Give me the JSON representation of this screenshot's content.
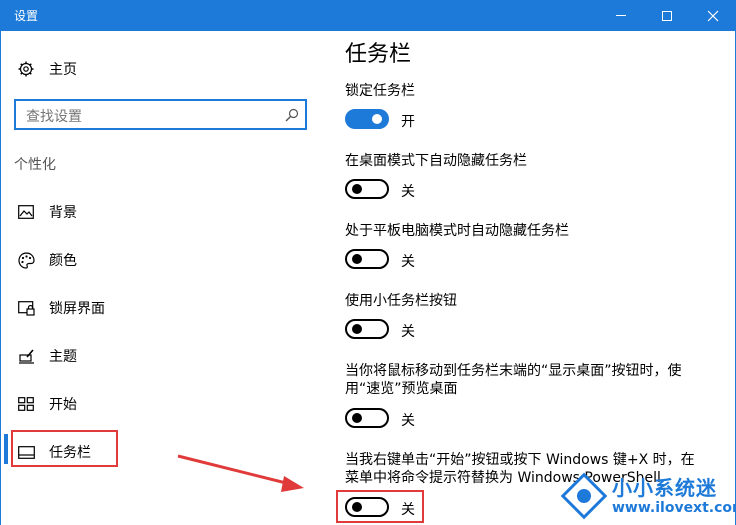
{
  "window": {
    "title": "设置"
  },
  "sidebar": {
    "home": "主页",
    "search_placeholder": "查找设置",
    "section": "个性化",
    "items": [
      {
        "label": "背景",
        "icon": "picture-icon"
      },
      {
        "label": "颜色",
        "icon": "palette-icon"
      },
      {
        "label": "锁屏界面",
        "icon": "lock-screen-icon"
      },
      {
        "label": "主题",
        "icon": "theme-brush-icon"
      },
      {
        "label": "开始",
        "icon": "start-tiles-icon"
      },
      {
        "label": "任务栏",
        "icon": "taskbar-icon",
        "selected": true
      }
    ]
  },
  "content": {
    "title": "任务栏",
    "settings": [
      {
        "label": "锁定任务栏",
        "state": "开",
        "on": true
      },
      {
        "label": "在桌面模式下自动隐藏任务栏",
        "state": "关",
        "on": false
      },
      {
        "label": "处于平板电脑模式时自动隐藏任务栏",
        "state": "关",
        "on": false
      },
      {
        "label": "使用小任务栏按钮",
        "state": "关",
        "on": false
      },
      {
        "label": "当你将鼠标移动到任务栏末端的“显示桌面”按钮时，使用“速览”预览桌面",
        "state": "关",
        "on": false
      },
      {
        "label": "当我右键单击“开始”按钮或按下 Windows 键+X 时，在菜单中将命令提示符替换为 Windows PowerShell",
        "state": "关",
        "on": false
      }
    ]
  },
  "watermark": {
    "name": "小小系统迷",
    "url": "www.ilovext.com"
  },
  "colors": {
    "accent": "#1e7ad9",
    "annotation": "#e03a3a"
  }
}
